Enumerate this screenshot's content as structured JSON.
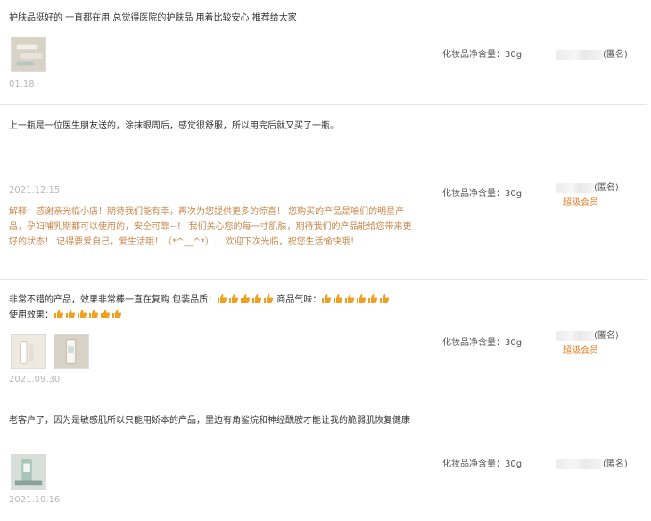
{
  "reviews": [
    {
      "text": "护肤品挺好的 一直都在用 总觉得医院的护肤品 用着比较安心 推荐给大家",
      "date": "01.18",
      "spec": "化妆品净含量：30g",
      "user_suffix": "(匿名)",
      "vip": ""
    },
    {
      "text": "上一瓶是一位医生朋友送的，涂抹眼周后，感觉很舒服，所以用完后就又买了一瓶。",
      "date": "2021.12.15",
      "spec": "化妆品净含量：30g",
      "user_suffix": "(匿名)",
      "vip": "超级会员",
      "reply": "解释：感谢亲光临小店！期待我们能有幸，再次为您提供更多的惊喜！ 您购买的产品是咱们的明星产品，孕妇哺乳期都可以使用的，安全可靠~！ 我们关心您的每一寸肌肤，期待我们的产品能给您带来更好的状态！ 记得要爱自己，爱生活哦！（*^__^*）... 欢迎下次光临，祝您生活愉快哦！"
    },
    {
      "text_prefix": "非常不错的产品，效果非常棒一直在复购 包装品质：",
      "text_mid": " 商品气味：",
      "text_line2": "使用效果：",
      "date": "2021.09.30",
      "spec": "化妆品净含量：30g",
      "user_suffix": "(匿名)",
      "vip": "超级会员"
    },
    {
      "text": "老客户了，因为是敏感肌所以只能用娇本的产品，里边有角鲨烷和神经酰胺才能让我的脆弱肌恢复健康",
      "date": "2021.10.16",
      "spec": "化妆品净含量：30g",
      "user_suffix": "(匿名)",
      "vip": ""
    }
  ]
}
